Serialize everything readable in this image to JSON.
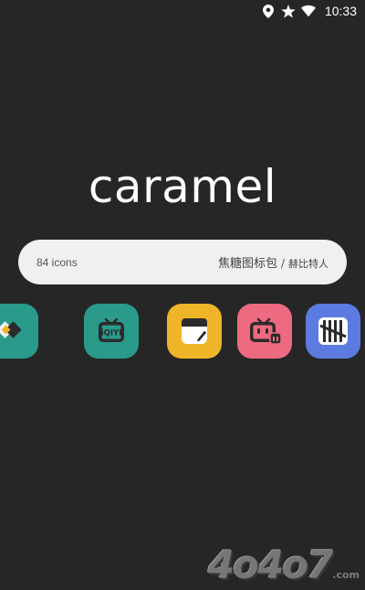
{
  "status_bar": {
    "time": "10:33",
    "icons": [
      "location-icon",
      "star-icon",
      "wifi-icon"
    ]
  },
  "title": "caramel",
  "info_bar": {
    "count": "84 icons",
    "pack_name": "焦糖图标包",
    "separator": "/",
    "author": "赫比特人",
    "background": "#f0f0f0"
  },
  "app_icons": [
    {
      "name": "teal-diamonds-app",
      "color": "#2a9b8a"
    },
    {
      "name": "iqiyi-app",
      "color": "#2a9b8a",
      "label": "iQIYI"
    },
    {
      "name": "notes-app",
      "color": "#f0b429"
    },
    {
      "name": "bilibili-app",
      "color": "#ee6a80"
    },
    {
      "name": "tally-app",
      "color": "#5b7be0"
    }
  ],
  "watermark": {
    "main": "4o4o7",
    "domain": ".com"
  },
  "colors": {
    "background": "#262626",
    "text_primary": "#ffffff"
  }
}
